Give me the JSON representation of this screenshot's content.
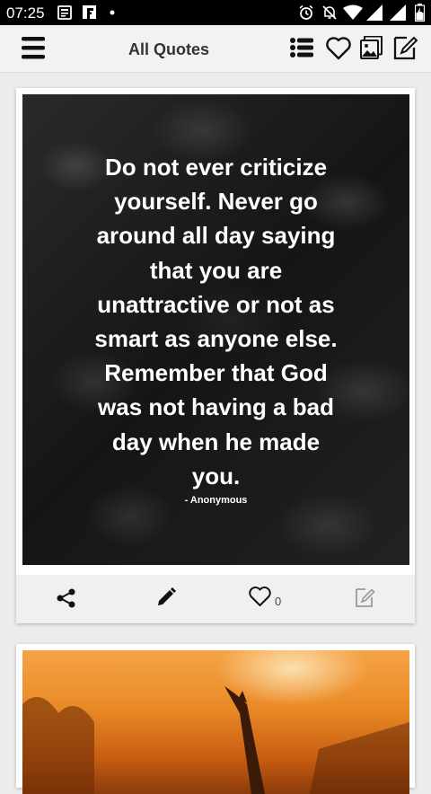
{
  "status_bar": {
    "time": "07:25",
    "icons": [
      "news-icon",
      "flipboard-icon",
      "dot-icon",
      "alarm-icon",
      "mute-icon",
      "wifi-icon",
      "signal-icon",
      "signal2-icon",
      "battery-icon"
    ]
  },
  "toolbar": {
    "title": "All Quotes",
    "icons": [
      "menu-icon",
      "list-icon",
      "heart-icon",
      "gallery-icon",
      "edit-icon"
    ]
  },
  "cards": [
    {
      "quote_lines": [
        "Do not ever criticize",
        "yourself. Never go",
        "around all day saying",
        "that you are",
        "unattractive or not as",
        "smart as anyone else.",
        "Remember that God",
        "was not having a bad",
        "day when he made",
        "you."
      ],
      "author": "- Anonymous",
      "like_count": "0",
      "actions": [
        "share-icon",
        "edit-pencil-icon",
        "like-icon",
        "write-icon"
      ]
    }
  ],
  "colors": {
    "status_bar": "#000000",
    "toolbar": "#f2f2f2",
    "page_bg": "#ececec",
    "action_bar": "#f0f0f0"
  }
}
